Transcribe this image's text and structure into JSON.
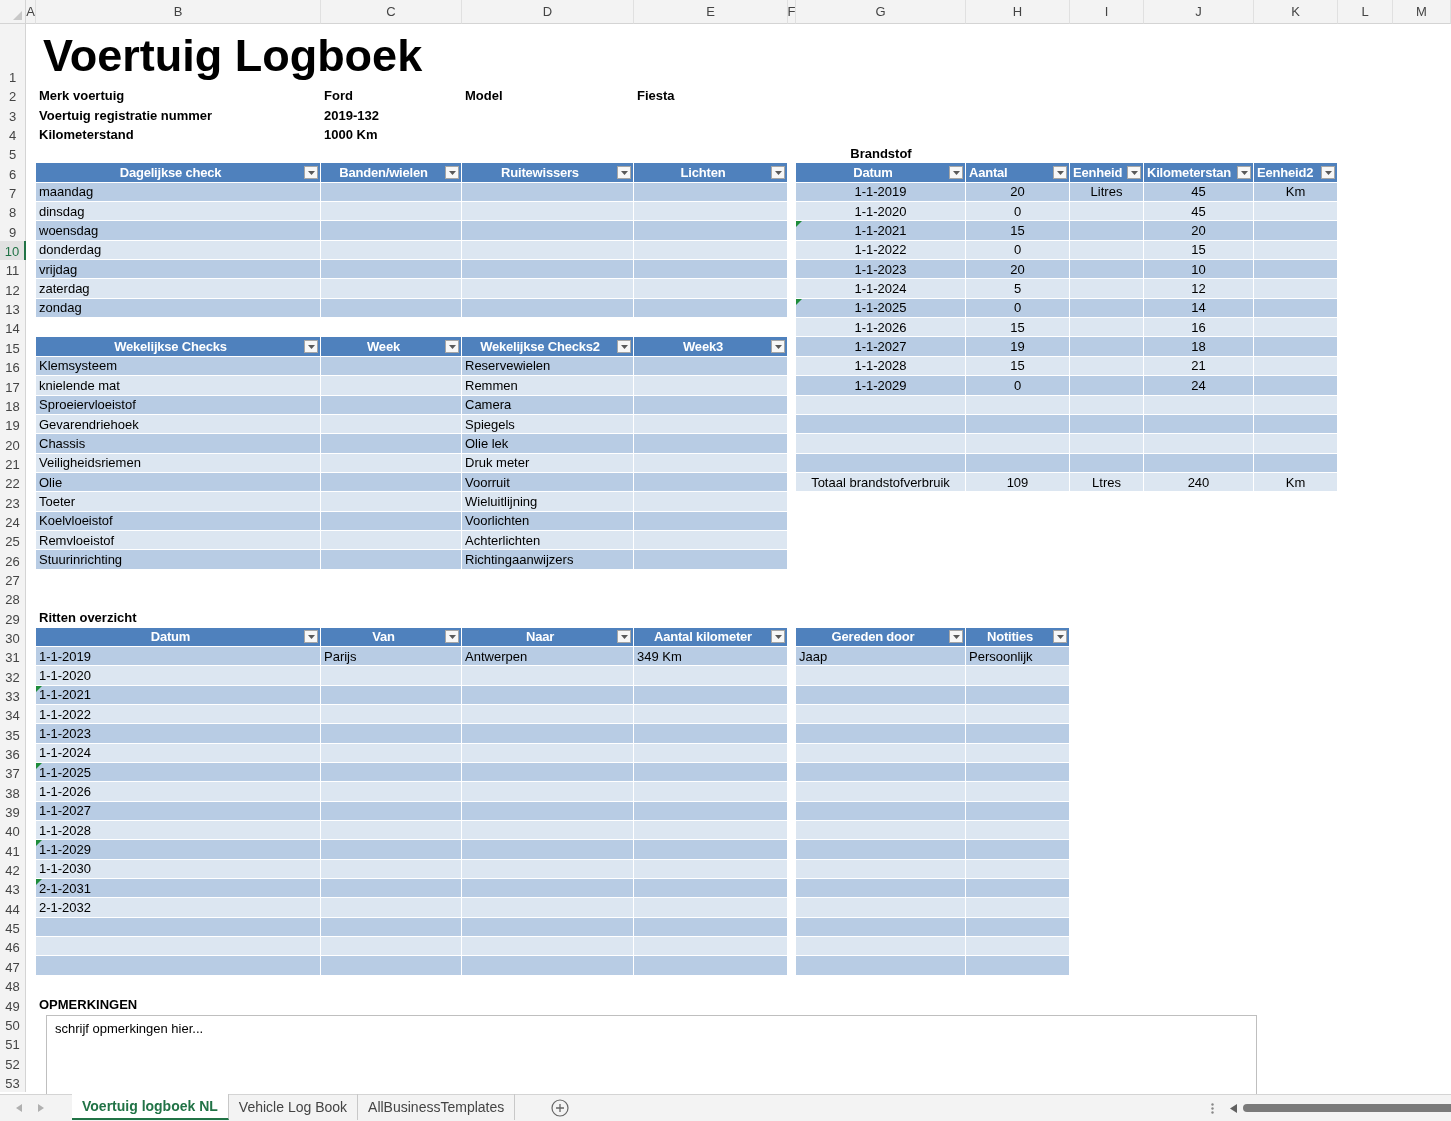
{
  "column_headers": [
    "A",
    "B",
    "C",
    "D",
    "E",
    "F",
    "G",
    "H",
    "I",
    "J",
    "K",
    "L",
    "M"
  ],
  "row_numbers": [
    {
      "label": "1",
      "selected": false
    },
    {
      "label": "2",
      "selected": false
    },
    {
      "label": "3",
      "selected": false
    },
    {
      "label": "4",
      "selected": false
    },
    {
      "label": "5",
      "selected": false
    },
    {
      "label": "6",
      "selected": false
    },
    {
      "label": "7",
      "selected": false
    },
    {
      "label": "8",
      "selected": false
    },
    {
      "label": "9",
      "selected": false
    },
    {
      "label": "10",
      "selected": true
    },
    {
      "label": "11",
      "selected": false
    },
    {
      "label": "12",
      "selected": false
    },
    {
      "label": "13",
      "selected": false
    },
    {
      "label": "14",
      "selected": false
    },
    {
      "label": "15",
      "selected": false
    },
    {
      "label": "16",
      "selected": false
    },
    {
      "label": "17",
      "selected": false
    },
    {
      "label": "18",
      "selected": false
    },
    {
      "label": "19",
      "selected": false
    },
    {
      "label": "20",
      "selected": false
    },
    {
      "label": "21",
      "selected": false
    },
    {
      "label": "22",
      "selected": false
    },
    {
      "label": "23",
      "selected": false
    },
    {
      "label": "24",
      "selected": false
    },
    {
      "label": "25",
      "selected": false
    },
    {
      "label": "26",
      "selected": false
    },
    {
      "label": "27",
      "selected": false
    },
    {
      "label": "28",
      "selected": false
    },
    {
      "label": "29",
      "selected": false
    },
    {
      "label": "30",
      "selected": false
    },
    {
      "label": "31",
      "selected": false
    },
    {
      "label": "32",
      "selected": false
    },
    {
      "label": "33",
      "selected": false
    },
    {
      "label": "34",
      "selected": false
    },
    {
      "label": "35",
      "selected": false
    },
    {
      "label": "36",
      "selected": false
    },
    {
      "label": "37",
      "selected": false
    },
    {
      "label": "38",
      "selected": false
    },
    {
      "label": "39",
      "selected": false
    },
    {
      "label": "40",
      "selected": false
    },
    {
      "label": "41",
      "selected": false
    },
    {
      "label": "42",
      "selected": false
    },
    {
      "label": "43",
      "selected": false
    },
    {
      "label": "44",
      "selected": false
    },
    {
      "label": "45",
      "selected": false
    },
    {
      "label": "46",
      "selected": false
    },
    {
      "label": "47",
      "selected": false
    },
    {
      "label": "48",
      "selected": false
    },
    {
      "label": "49",
      "selected": false
    },
    {
      "label": "50",
      "selected": false
    },
    {
      "label": "51",
      "selected": false
    },
    {
      "label": "52",
      "selected": false
    },
    {
      "label": "53",
      "selected": false
    }
  ],
  "title": "Voertuig Logboek",
  "vehicle_info": [
    {
      "label": "Merk voertuig",
      "value": "Ford"
    },
    {
      "label": "Voertuig registratie nummer",
      "value": "2019-132"
    },
    {
      "label": "Kilometerstand",
      "value": "1000 Km"
    }
  ],
  "model": {
    "label": "Model",
    "value": "Fiesta"
  },
  "daily_checks": {
    "columns": [
      "Dagelijkse check",
      "Banden/wielen",
      "Ruitewissers",
      "Lichten"
    ],
    "rows": [
      "maandag",
      "dinsdag",
      "woensdag",
      "donderdag",
      "vrijdag",
      "zaterdag",
      "zondag"
    ]
  },
  "weekly_checks": {
    "columns": [
      "Wekelijkse Checks",
      "Week",
      "Wekelijkse Checks2",
      "Week3"
    ],
    "rows": [
      {
        "item": "Klemsysteem",
        "item2": "Reservewielen"
      },
      {
        "item": "knielende mat",
        "item2": "Remmen"
      },
      {
        "item": "Sproeiervloeistof",
        "item2": "Camera"
      },
      {
        "item": "Gevarendriehoek",
        "item2": "Spiegels"
      },
      {
        "item": "Chassis",
        "item2": "Olie lek"
      },
      {
        "item": "Veiligheidsriemen",
        "item2": "Druk meter"
      },
      {
        "item": "Olie",
        "item2": "Voorruit"
      },
      {
        "item": "Toeter",
        "item2": "Wieluitlijning"
      },
      {
        "item": "Koelvloeistof",
        "item2": "Voorlichten"
      },
      {
        "item": "Remvloeistof",
        "item2": "Achterlichten"
      },
      {
        "item": "Stuurinrichting",
        "item2": "Richtingaanwijzers"
      }
    ]
  },
  "fuel": {
    "title": "Brandstof",
    "columns": [
      "Datum",
      "Aantal",
      "Eenheid",
      "Kilometerstan",
      "Eenheid2"
    ],
    "rows": [
      {
        "date": "1-1-2019",
        "amount": "20",
        "unit": "Litres",
        "km": "45",
        "unit2": "Km",
        "flagged": false
      },
      {
        "date": "1-1-2020",
        "amount": "0",
        "km": "45",
        "flagged": false
      },
      {
        "date": "1-1-2021",
        "amount": "15",
        "km": "20",
        "flagged": true
      },
      {
        "date": "1-1-2022",
        "amount": "0",
        "km": "15",
        "flagged": false
      },
      {
        "date": "1-1-2023",
        "amount": "20",
        "km": "10",
        "flagged": false
      },
      {
        "date": "1-1-2024",
        "amount": "5",
        "km": "12",
        "flagged": false
      },
      {
        "date": "1-1-2025",
        "amount": "0",
        "km": "14",
        "flagged": true
      },
      {
        "date": "1-1-2026",
        "amount": "15",
        "km": "16",
        "flagged": false
      },
      {
        "date": "1-1-2027",
        "amount": "19",
        "km": "18",
        "flagged": false
      },
      {
        "date": "1-1-2028",
        "amount": "15",
        "km": "21",
        "flagged": false
      },
      {
        "date": "1-1-2029",
        "amount": "0",
        "km": "24",
        "flagged": false
      }
    ],
    "total": {
      "label": "Totaal brandstofverbruik",
      "amount": "109",
      "unit": "Ltres",
      "km": "240",
      "unit2": "Km"
    }
  },
  "trips": {
    "title": "Ritten overzicht",
    "columns": [
      "Datum",
      "Van",
      "Naar",
      "Aantal kilometer",
      "Gereden door",
      "Notities"
    ],
    "rows": [
      {
        "date": "1-1-2019",
        "from": "Parijs",
        "to": "Antwerpen",
        "km": "349 Km",
        "driver": "Jaap",
        "notes": "Persoonlijk",
        "flagged": false
      },
      {
        "date": "1-1-2020",
        "flagged": false
      },
      {
        "date": "1-1-2021",
        "flagged": true
      },
      {
        "date": "1-1-2022",
        "flagged": false
      },
      {
        "date": "1-1-2023",
        "flagged": false
      },
      {
        "date": "1-1-2024",
        "flagged": false
      },
      {
        "date": "1-1-2025",
        "flagged": true
      },
      {
        "date": "1-1-2026",
        "flagged": false
      },
      {
        "date": "1-1-2027",
        "flagged": false
      },
      {
        "date": "1-1-2028",
        "flagged": false
      },
      {
        "date": "1-1-2029",
        "flagged": true
      },
      {
        "date": "1-1-2030",
        "flagged": false
      },
      {
        "date": "2-1-2031",
        "flagged": true
      },
      {
        "date": "2-1-2032",
        "flagged": false
      }
    ]
  },
  "remarks": {
    "label": "OPMERKINGEN",
    "text": "schrijf opmerkingen hier..."
  },
  "sheet_tabs": [
    {
      "label": "Voertuig logboek NL",
      "selected": true
    },
    {
      "label": "Vehicle Log Book",
      "selected": false
    },
    {
      "label": "AllBusinessTemplates",
      "selected": false
    }
  ]
}
